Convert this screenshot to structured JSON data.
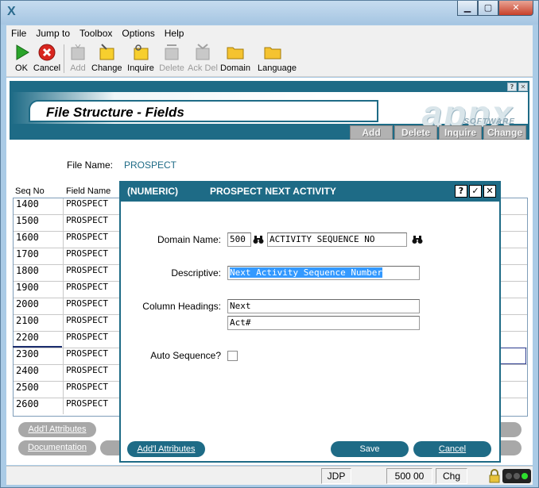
{
  "window": {
    "logo": "X",
    "controls": {
      "minimize": "▁",
      "maximize": "▢",
      "close": "✕"
    }
  },
  "menu": [
    "File",
    "Jump to",
    "Toolbox",
    "Options",
    "Help"
  ],
  "toolbar": [
    {
      "label": "OK",
      "icon": "play-icon",
      "enabled": true
    },
    {
      "label": "Cancel",
      "icon": "cancel-icon",
      "enabled": true
    },
    {
      "label": "Add",
      "icon": "add-icon",
      "enabled": false
    },
    {
      "label": "Change",
      "icon": "change-icon",
      "enabled": true
    },
    {
      "label": "Inquire",
      "icon": "inquire-icon",
      "enabled": true
    },
    {
      "label": "Delete",
      "icon": "delete-icon",
      "enabled": false
    },
    {
      "label": "Ack Del",
      "icon": "ack-delete-icon",
      "enabled": false
    },
    {
      "label": "Domain",
      "icon": "folder-icon",
      "enabled": true
    },
    {
      "label": "Language",
      "icon": "folder-icon",
      "enabled": true
    }
  ],
  "header": {
    "title": "File Structure - Fields",
    "logo_text": "appx",
    "logo_sub": "SOFTWARE",
    "mini_help": "?",
    "mini_close": "✕",
    "actions": [
      "Add",
      "Delete",
      "Inquire",
      "Change"
    ]
  },
  "file": {
    "label": "File Name:",
    "value": "PROSPECT"
  },
  "grid": {
    "columns": [
      "Seq No",
      "Field Name"
    ],
    "rows": [
      {
        "seq": "1400",
        "field": "PROSPECT"
      },
      {
        "seq": "1500",
        "field": "PROSPECT"
      },
      {
        "seq": "1600",
        "field": "PROSPECT"
      },
      {
        "seq": "1700",
        "field": "PROSPECT"
      },
      {
        "seq": "1800",
        "field": "PROSPECT"
      },
      {
        "seq": "1900",
        "field": "PROSPECT"
      },
      {
        "seq": "2000",
        "field": "PROSPECT"
      },
      {
        "seq": "2100",
        "field": "PROSPECT"
      },
      {
        "seq": "2200",
        "field": "PROSPECT"
      },
      {
        "seq": "2300",
        "field": "PROSPECT"
      },
      {
        "seq": "2400",
        "field": "PROSPECT"
      },
      {
        "seq": "2500",
        "field": "PROSPECT"
      },
      {
        "seq": "2600",
        "field": "PROSPECT"
      }
    ]
  },
  "bottom_buttons": {
    "attributes": "Add'l Attributes",
    "documentation": "Documentation"
  },
  "dialog": {
    "type": "(NUMERIC)",
    "caption": "PROSPECT NEXT ACTIVITY",
    "help": "?",
    "ok": "✓",
    "close": "✕",
    "domain": {
      "label": "Domain Name:",
      "code": "500",
      "name": "ACTIVITY SEQUENCE NO"
    },
    "descriptive": {
      "label": "Descriptive:",
      "value": "Next Activity Sequence Number"
    },
    "headings": {
      "label": "Column Headings:",
      "line1": "Next",
      "line2": "Act#"
    },
    "auto_sequence": {
      "label": "Auto Sequence?",
      "checked": false
    },
    "buttons": {
      "attributes": "Add'l Attributes",
      "save": "Save",
      "cancel": "Cancel"
    }
  },
  "status": {
    "user": "JDP",
    "code": "500 00",
    "mode": "Chg"
  },
  "colors": {
    "accent": "#1e6b86",
    "selection": "#3399ff"
  }
}
